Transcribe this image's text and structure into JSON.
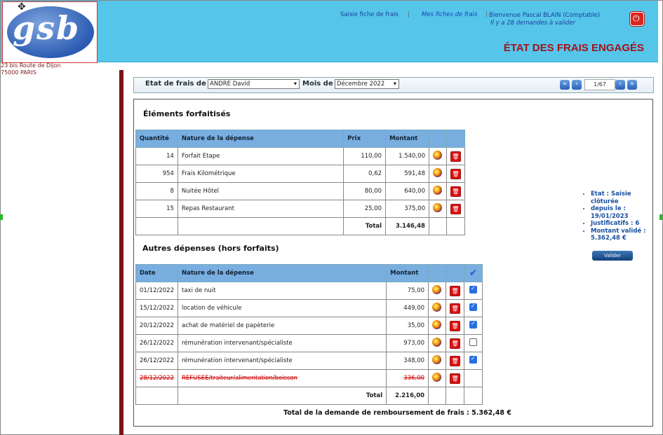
{
  "header": {
    "logo_text": "gsb",
    "nav": [
      "Saisie fiche de frais",
      "|",
      "Mes fiches de frais",
      "|"
    ],
    "welcome": "Bienvenue Pascal BLAIN (Comptable)",
    "pending": "Il y a 28 demandes à valider",
    "title": "ÉTAT DES FRAIS ENGAGÉS"
  },
  "address": {
    "line1": "23 bis Route de Dijon",
    "line2": "75000 PARIS"
  },
  "filter": {
    "label_user": "Etat de frais de",
    "user": "ANDRE David",
    "label_month": "Mois de",
    "month": "Décembre 2022",
    "page": "1/67",
    "nav_icons": [
      "first-icon",
      "prev-icon",
      "next-icon",
      "last-icon"
    ]
  },
  "forfait": {
    "title": "Éléments forfaitisés",
    "headers": [
      "Quantité",
      "Nature de la dépense",
      "Prix",
      "Montant"
    ],
    "rows": [
      [
        "14",
        "Forfait Etape",
        "110,00",
        "1.540,00"
      ],
      [
        "954",
        "Frais Kilométrique",
        "0,62",
        "591,48"
      ],
      [
        "8",
        "Nuitée Hôtel",
        "80,00",
        "640,00"
      ],
      [
        "15",
        "Repas Restaurant",
        "25,00",
        "375,00"
      ]
    ],
    "total_label": "Total",
    "total": "3.146,48"
  },
  "hors": {
    "title": "Autres dépenses (hors forfaits)",
    "headers": [
      "Date",
      "Nature de la dépense",
      "Montant"
    ],
    "rows": [
      [
        "01/12/2022",
        "taxi de nuit",
        "75,00",
        true
      ],
      [
        "15/12/2022",
        "location de véhicule",
        "449,00",
        true
      ],
      [
        "20/12/2022",
        "achat de matériel de papèterie",
        "35,00",
        true
      ],
      [
        "26/12/2022",
        "rémunération intervenant/spécialiste",
        "973,00",
        false
      ],
      [
        "26/12/2022",
        "rémunération intervenant/spécialiste",
        "348,00",
        true
      ],
      [
        "28/12/2022",
        "REFUSEE/traiteur/alimentation/boisson",
        "336,00",
        null
      ]
    ],
    "total_label": "Total",
    "total": "2.216,00"
  },
  "status": {
    "etat": "Etat : Saisie clôturée",
    "depuis": "depuis le : 19/01/2023",
    "justificatifs": "Justificatifs : 6",
    "montant": "Montant validé : 5.362,48 €",
    "button": "Valider"
  },
  "grand_total": "Total de la demande de remboursement de frais : 5.362,48 €"
}
